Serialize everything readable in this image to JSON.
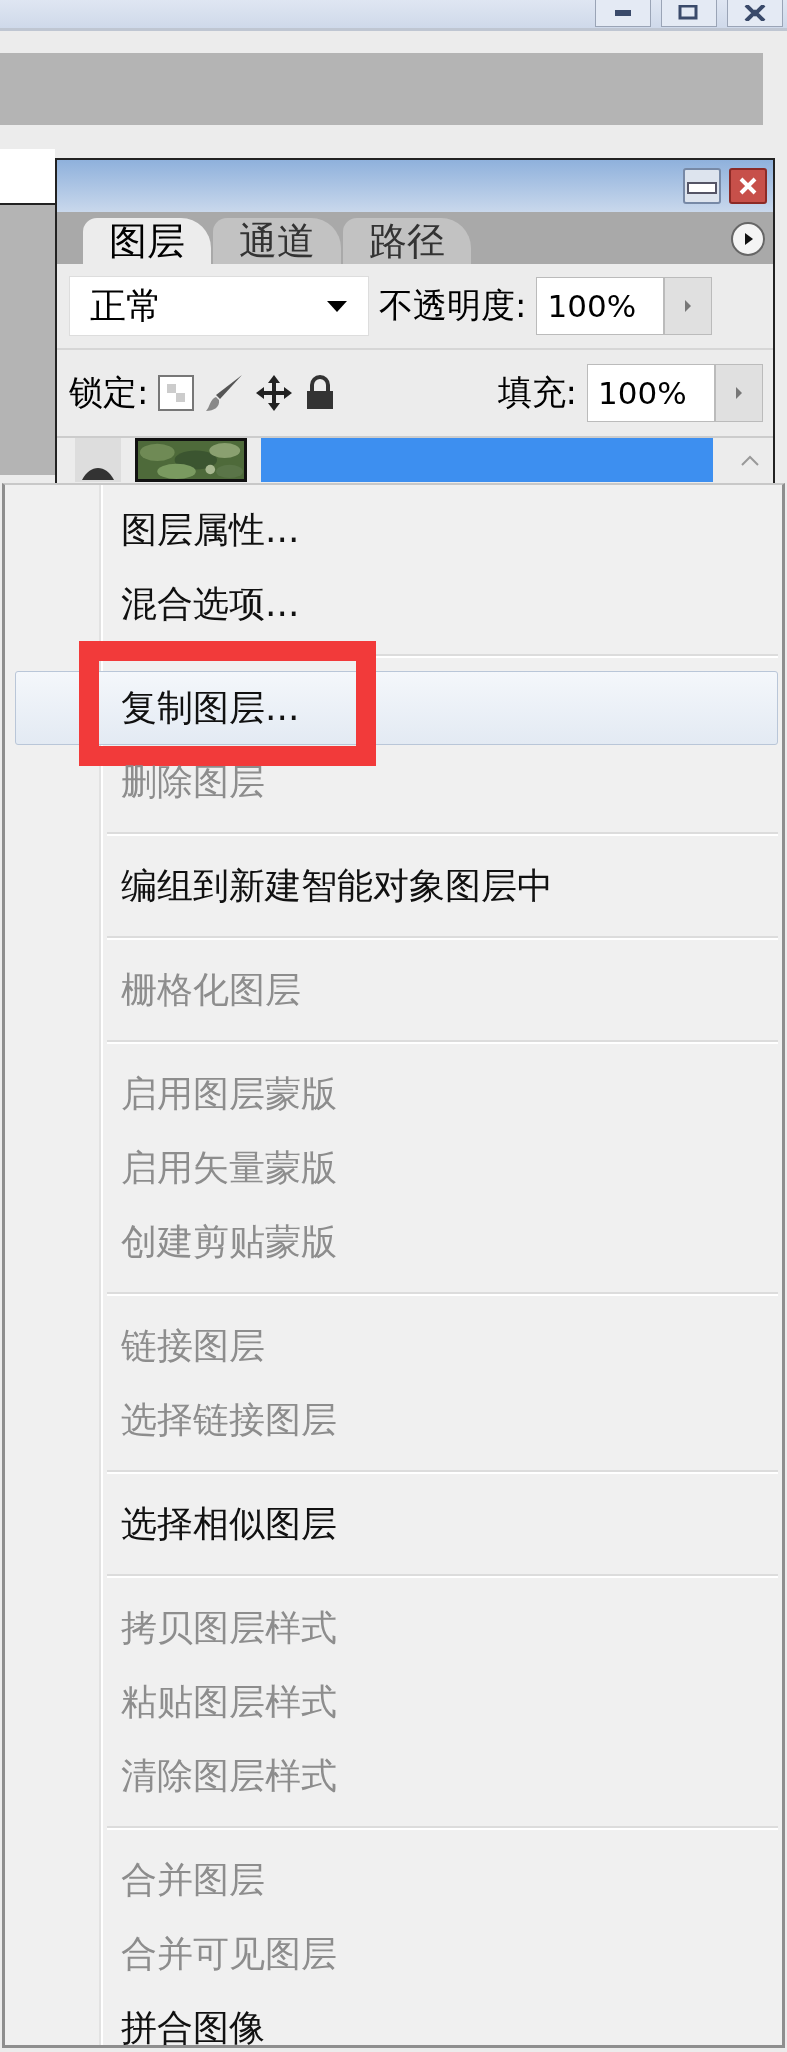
{
  "layers_panel": {
    "tabs": [
      {
        "label": "图层",
        "selected": true
      },
      {
        "label": "通道",
        "selected": false
      },
      {
        "label": "路径",
        "selected": false
      }
    ],
    "blend_mode": "正常",
    "opacity_label": "不透明度:",
    "opacity": "100%",
    "lock_label": "锁定:",
    "fill_label": "填充:",
    "fill": "100%",
    "layer_row": {
      "selected": true
    }
  },
  "context_menu": {
    "groups": [
      {
        "items": [
          {
            "label": "图层属性...",
            "disabled": false,
            "selected": false,
            "annotated": false
          },
          {
            "label": "混合选项...",
            "disabled": false,
            "selected": false,
            "annotated": false
          }
        ]
      },
      {
        "items": [
          {
            "label": "复制图层...",
            "disabled": false,
            "selected": true,
            "annotated": true
          },
          {
            "label": "删除图层",
            "disabled": true,
            "selected": false,
            "annotated": false
          }
        ]
      },
      {
        "items": [
          {
            "label": "编组到新建智能对象图层中",
            "disabled": false,
            "selected": false,
            "annotated": false
          }
        ]
      },
      {
        "items": [
          {
            "label": "栅格化图层",
            "disabled": true,
            "selected": false,
            "annotated": false
          }
        ]
      },
      {
        "items": [
          {
            "label": "启用图层蒙版",
            "disabled": true,
            "selected": false,
            "annotated": false
          },
          {
            "label": "启用矢量蒙版",
            "disabled": true,
            "selected": false,
            "annotated": false
          },
          {
            "label": "创建剪贴蒙版",
            "disabled": true,
            "selected": false,
            "annotated": false
          }
        ]
      },
      {
        "items": [
          {
            "label": "链接图层",
            "disabled": true,
            "selected": false,
            "annotated": false
          },
          {
            "label": "选择链接图层",
            "disabled": true,
            "selected": false,
            "annotated": false
          }
        ]
      },
      {
        "items": [
          {
            "label": "选择相似图层",
            "disabled": false,
            "selected": false,
            "annotated": false
          }
        ]
      },
      {
        "items": [
          {
            "label": "拷贝图层样式",
            "disabled": true,
            "selected": false,
            "annotated": false
          },
          {
            "label": "粘贴图层样式",
            "disabled": true,
            "selected": false,
            "annotated": false
          },
          {
            "label": "清除图层样式",
            "disabled": true,
            "selected": false,
            "annotated": false
          }
        ]
      },
      {
        "items": [
          {
            "label": "合并图层",
            "disabled": true,
            "selected": false,
            "annotated": false
          },
          {
            "label": "合并可见图层",
            "disabled": true,
            "selected": false,
            "annotated": false
          },
          {
            "label": "拼合图像",
            "disabled": false,
            "selected": false,
            "annotated": false
          }
        ]
      }
    ]
  }
}
